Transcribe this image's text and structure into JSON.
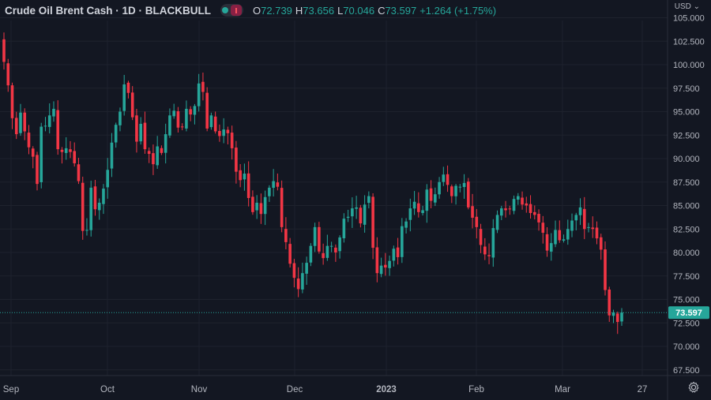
{
  "header": {
    "title": "Crude Oil Brent Cash · 1D · BLACKBULL",
    "o_label": "O",
    "o_value": "72.739",
    "h_label": "H",
    "h_value": "73.656",
    "l_label": "L",
    "l_value": "70.046",
    "c_label": "C",
    "c_value": "73.597",
    "change": "+1.264 (+1.75%)"
  },
  "currency": "USD ⌄",
  "icons": {
    "settings": "gear-icon",
    "visibility": "eye-toggle-icon"
  },
  "colors": {
    "up": "#26a69a",
    "down": "#f23645",
    "background": "#131722",
    "grid": "#1e222d"
  },
  "chart_data": {
    "type": "candlestick",
    "ylim": [
      66.2,
      106.0
    ],
    "y_ticks": [
      "105.000",
      "102.500",
      "100.000",
      "97.500",
      "95.000",
      "92.500",
      "90.000",
      "87.500",
      "85.000",
      "82.500",
      "80.000",
      "77.500",
      "75.000",
      "72.500",
      "70.000",
      "67.500"
    ],
    "x_ticks": [
      "Sep",
      "Oct",
      "Nov",
      "Dec",
      "2023",
      "Feb",
      "Mar",
      "27"
    ],
    "last_price": "73.597",
    "close": [
      100.3,
      97.8,
      94.3,
      92.6,
      94.9,
      92.9,
      91.2,
      90.2,
      87.3,
      93.4,
      93.5,
      94.6,
      95.3,
      91.0,
      90.7,
      91.1,
      90.7,
      89.5,
      87.6,
      82.3,
      82.4,
      86.9,
      84.6,
      85.3,
      86.8,
      88.8,
      91.7,
      93.6,
      95.0,
      97.9,
      97.0,
      94.4,
      91.8,
      93.7,
      91.0,
      90.5,
      89.4,
      91.3,
      90.6,
      92.6,
      94.6,
      95.1,
      93.3,
      93.4,
      95.3,
      94.7,
      95.6,
      98.0,
      97.1,
      93.2,
      94.6,
      92.9,
      92.4,
      93.1,
      92.7,
      91.1,
      88.6,
      87.7,
      88.4,
      85.8,
      84.3,
      85.3,
      84.1,
      85.9,
      86.9,
      87.6,
      87.0,
      82.7,
      81.1,
      78.8,
      77.3,
      76.1,
      77.8,
      78.9,
      80.7,
      82.7,
      80.1,
      79.4,
      80.7,
      80.7,
      80.0,
      81.6,
      83.6,
      83.8,
      84.7,
      84.8,
      83.1,
      85.1,
      86.0,
      80.5,
      77.8,
      78.6,
      78.4,
      79.1,
      80.4,
      79.5,
      82.8,
      83.3,
      84.7,
      85.4,
      84.3,
      84.5,
      86.7,
      85.5,
      86.2,
      87.5,
      88.3,
      87.2,
      86.0,
      87.1,
      87.0,
      87.4,
      84.8,
      83.7,
      82.7,
      80.8,
      79.8,
      79.6,
      82.6,
      84.0,
      84.7,
      84.5,
      84.6,
      85.7,
      86.0,
      85.1,
      85.0,
      84.2,
      84.0,
      83.2,
      82.1,
      80.2,
      81.0,
      82.4,
      81.3,
      81.4,
      82.5,
      83.4,
      84.0,
      84.8,
      82.5,
      82.7,
      82.5,
      81.5,
      80.3,
      76.0,
      73.3,
      73.6,
      72.6,
      73.6
    ]
  }
}
